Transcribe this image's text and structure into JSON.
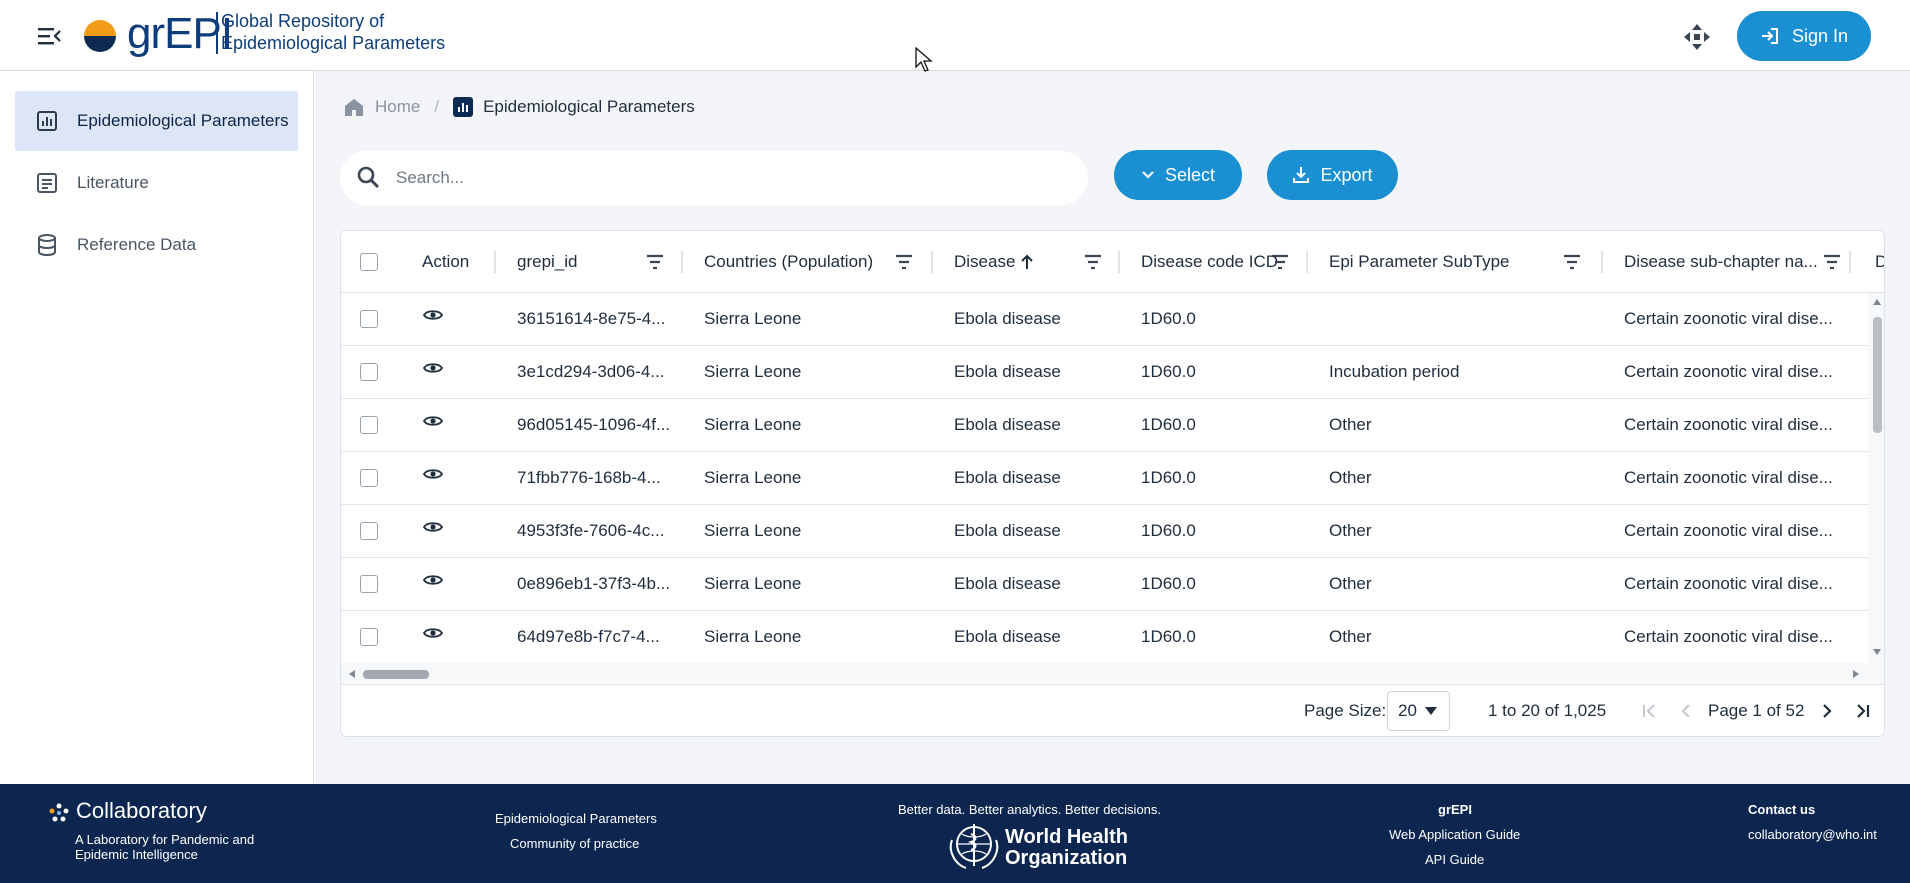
{
  "header": {
    "logo_text": "grEPI",
    "subtitle_line1": "Global Repository of",
    "subtitle_line2": "Epidemiological Parameters",
    "signin_label": "Sign In"
  },
  "sidebar": {
    "items": [
      {
        "label": "Epidemiological Parameters",
        "icon": "chart-icon",
        "active": true
      },
      {
        "label": "Literature",
        "icon": "document-icon",
        "active": false
      },
      {
        "label": "Reference Data",
        "icon": "database-icon",
        "active": false
      }
    ]
  },
  "breadcrumb": {
    "home": "Home",
    "separator": "/",
    "current": "Epidemiological Parameters"
  },
  "search": {
    "placeholder": "Search..."
  },
  "toolbar": {
    "select_label": "Select",
    "export_label": "Export"
  },
  "table": {
    "columns": [
      {
        "label": "Action"
      },
      {
        "label": "grepi_id"
      },
      {
        "label": "Countries (Population)"
      },
      {
        "label": "Disease",
        "sort": "ascending"
      },
      {
        "label": "Disease code ICD"
      },
      {
        "label": "Epi Parameter SubType"
      },
      {
        "label": "Disease sub-chapter na..."
      },
      {
        "label": "D"
      }
    ],
    "rows": [
      {
        "id": "36151614-8e75-4...",
        "country": "Sierra Leone",
        "disease": "Ebola disease",
        "icd": "1D60.0",
        "subtype": "",
        "subchapter": "Certain zoonotic viral dise..."
      },
      {
        "id": "3e1cd294-3d06-4...",
        "country": "Sierra Leone",
        "disease": "Ebola disease",
        "icd": "1D60.0",
        "subtype": "Incubation period",
        "subchapter": "Certain zoonotic viral dise..."
      },
      {
        "id": "96d05145-1096-4f...",
        "country": "Sierra Leone",
        "disease": "Ebola disease",
        "icd": "1D60.0",
        "subtype": "Other",
        "subchapter": "Certain zoonotic viral dise..."
      },
      {
        "id": "71fbb776-168b-4...",
        "country": "Sierra Leone",
        "disease": "Ebola disease",
        "icd": "1D60.0",
        "subtype": "Other",
        "subchapter": "Certain zoonotic viral dise..."
      },
      {
        "id": "4953f3fe-7606-4c...",
        "country": "Sierra Leone",
        "disease": "Ebola disease",
        "icd": "1D60.0",
        "subtype": "Other",
        "subchapter": "Certain zoonotic viral dise..."
      },
      {
        "id": "0e896eb1-37f3-4b...",
        "country": "Sierra Leone",
        "disease": "Ebola disease",
        "icd": "1D60.0",
        "subtype": "Other",
        "subchapter": "Certain zoonotic viral dise..."
      },
      {
        "id": "64d97e8b-f7c7-4...",
        "country": "Sierra Leone",
        "disease": "Ebola disease",
        "icd": "1D60.0",
        "subtype": "Other",
        "subchapter": "Certain zoonotic viral dise..."
      }
    ]
  },
  "pager": {
    "page_size_label": "Page Size:",
    "page_size_value": "20",
    "range_text": "1 to 20 of 1,025",
    "page_text": "Page 1 of 52"
  },
  "footer": {
    "brand": "Collaboratory",
    "brand_sub1": "A Laboratory for Pandemic and",
    "brand_sub2": "Epidemic Intelligence",
    "link1": "Epidemiological Parameters",
    "link2": "Community of practice",
    "tagline": "Better data. Better analytics. Better decisions.",
    "who_line1": "World Health",
    "who_line2": "Organization",
    "grepi_title": "grEPI",
    "grepi_link1": "Web Application Guide",
    "grepi_link2": "API Guide",
    "contact_title": "Contact us",
    "contact_email": "collaboratory@who.int"
  },
  "colors": {
    "primary": "#1a8fd1",
    "navy": "#0c2650",
    "active_bg": "#dde6f8"
  }
}
